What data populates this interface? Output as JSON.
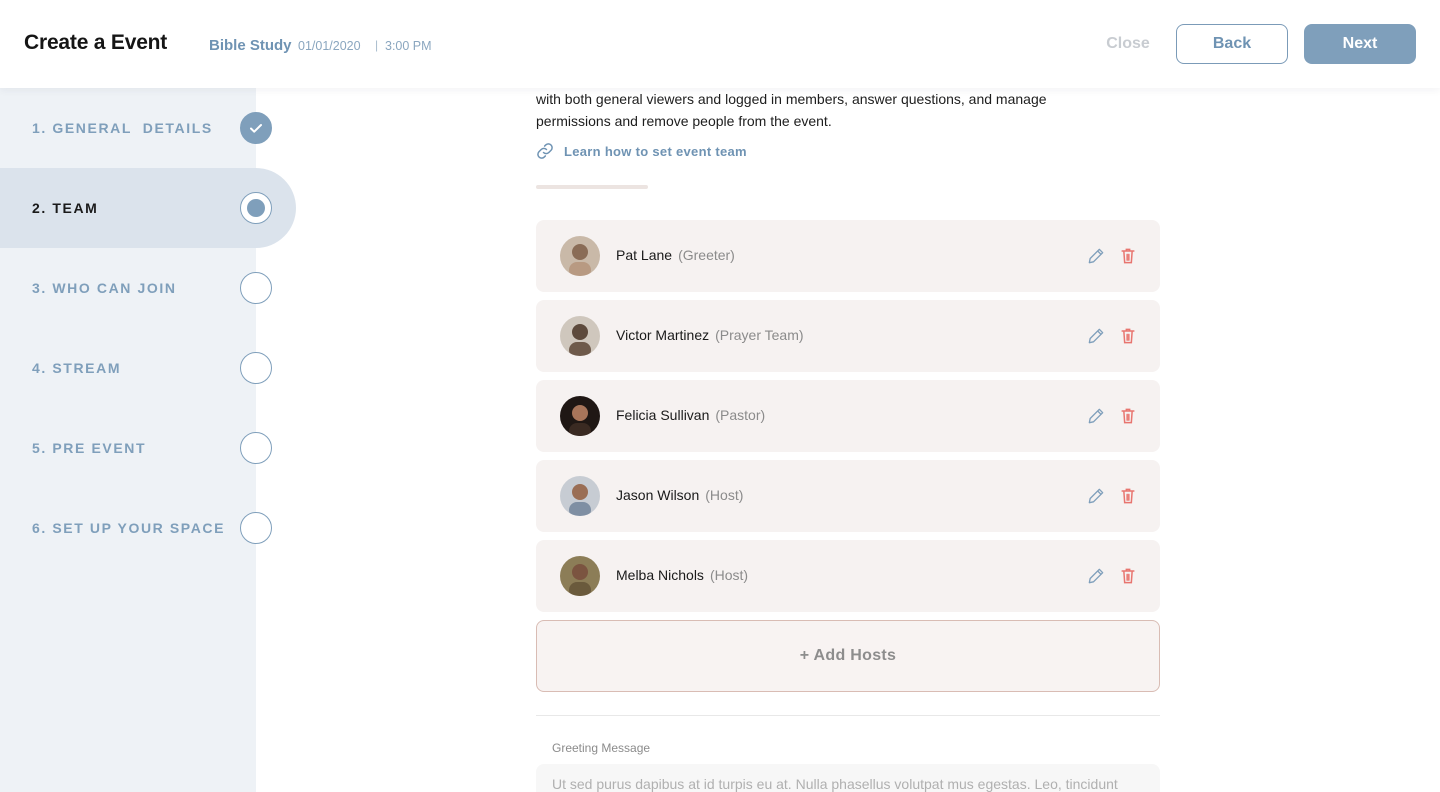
{
  "header": {
    "title": "Create a Event",
    "event_name": "Bible Study",
    "event_date": "01/01/2020",
    "separator": "|",
    "event_time": "3:00 PM",
    "close_label": "Close",
    "back_label": "Back",
    "next_label": "Next"
  },
  "sidebar": {
    "steps": [
      {
        "label": "1. GENERAL  DETAILS",
        "state": "done"
      },
      {
        "label": "2. TEAM",
        "state": "current"
      },
      {
        "label": "3. WHO CAN JOIN",
        "state": "todo"
      },
      {
        "label": "4. STREAM",
        "state": "todo"
      },
      {
        "label": "5. PRE EVENT",
        "state": "todo"
      },
      {
        "label": "6. SET UP YOUR SPACE",
        "state": "todo"
      }
    ]
  },
  "main": {
    "description": "with both general viewers and logged in members, answer questions, and manage permissions and remove people from the event.",
    "learn_link": "Learn how to set event team",
    "team": [
      {
        "name": "Pat Lane",
        "role": "(Greeter)",
        "avatar_color": "#b89a82"
      },
      {
        "name": "Victor Martinez",
        "role": "(Prayer Team)",
        "avatar_color": "#6e5a4b"
      },
      {
        "name": "Felicia Sullivan",
        "role": "(Pastor)",
        "avatar_color": "#3a2a22"
      },
      {
        "name": "Jason Wilson",
        "role": "(Host)",
        "avatar_color": "#7f8fa3"
      },
      {
        "name": "Melba Nichols",
        "role": "(Host)",
        "avatar_color": "#6a5a3c"
      }
    ],
    "add_hosts_label": "+ Add Hosts",
    "greeting_label": "Greeting Message",
    "greeting_text": "Ut sed purus dapibus at id turpis eu at. Nulla phasellus volutpat mus egestas. Leo, tincidunt"
  },
  "colors": {
    "accent": "#7f9fbb",
    "delete": "#e8756f",
    "sidebar_bg": "#eef2f6",
    "card_bg": "#f6f2f1"
  }
}
